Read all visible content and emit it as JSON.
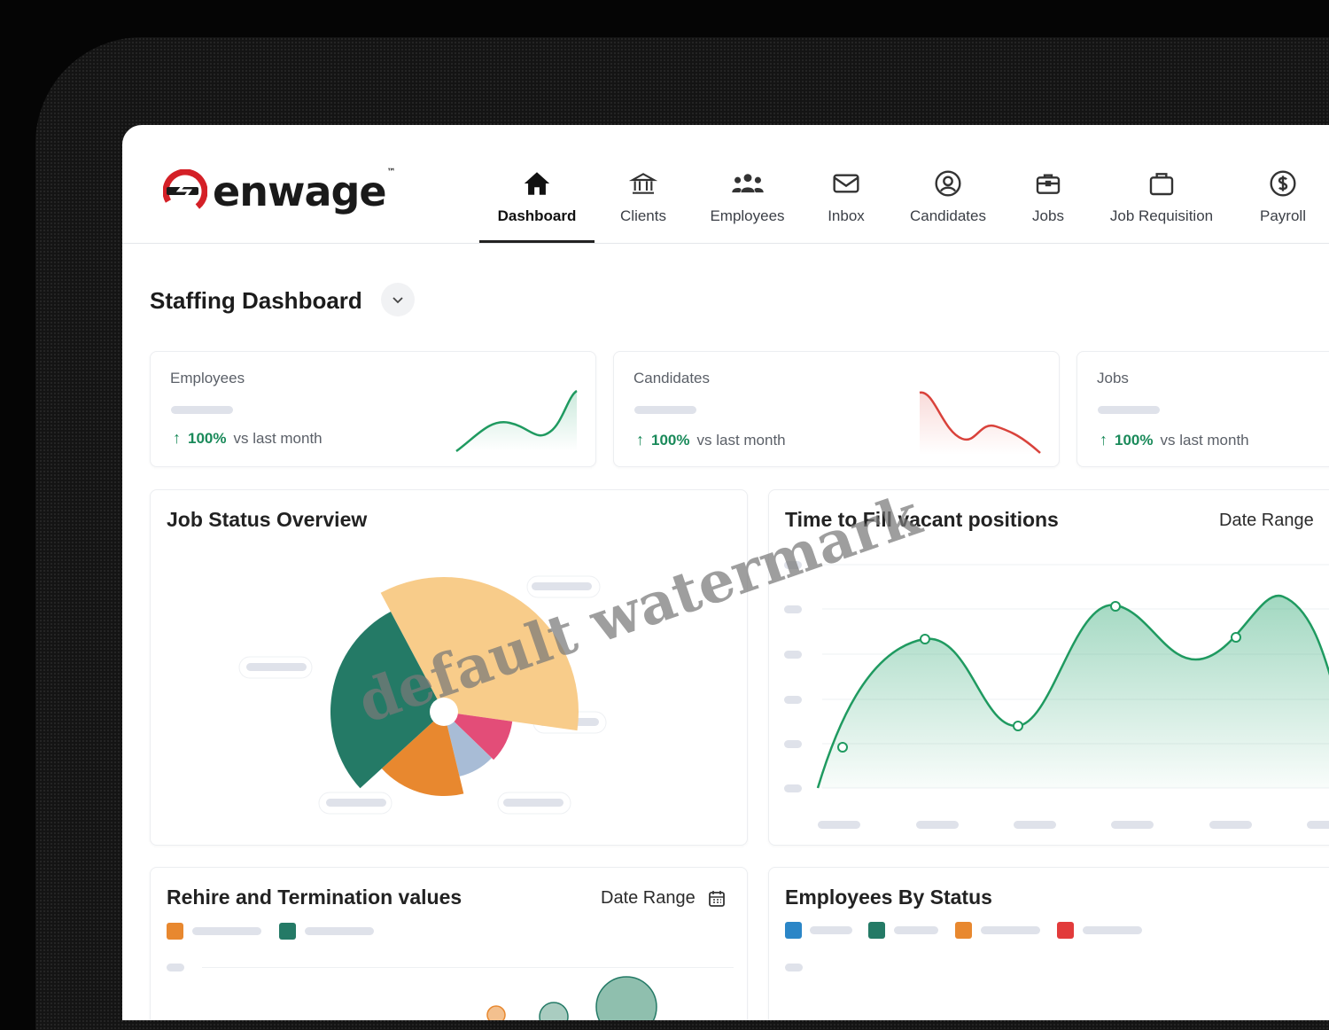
{
  "brand": {
    "name": "enwage",
    "tm": "™",
    "accent": "#d42027"
  },
  "nav": [
    {
      "label": "Dashboard",
      "icon": "home-icon",
      "active": true
    },
    {
      "label": "Clients",
      "icon": "bank-icon"
    },
    {
      "label": "Employees",
      "icon": "people-icon"
    },
    {
      "label": "Inbox",
      "icon": "mail-icon"
    },
    {
      "label": "Candidates",
      "icon": "user-circle-icon"
    },
    {
      "label": "Jobs",
      "icon": "briefcase-icon"
    },
    {
      "label": "Job Requisition",
      "icon": "bag-icon"
    },
    {
      "label": "Payroll",
      "icon": "dollar-circle-icon"
    }
  ],
  "page": {
    "title": "Staffing Dashboard"
  },
  "stats": [
    {
      "label": "Employees",
      "arrow": "↑",
      "delta": "100%",
      "suffix": "vs last month",
      "trend": "up",
      "color": "#1f9a60"
    },
    {
      "label": "Candidates",
      "arrow": "↑",
      "delta": "100%",
      "suffix": "vs last month",
      "trend": "down",
      "color": "#d9423b"
    },
    {
      "label": "Jobs",
      "arrow": "↑",
      "delta": "100%",
      "suffix": "vs last month"
    }
  ],
  "job_status": {
    "title": "Job Status Overview",
    "segments": [
      {
        "color": "#f8cc8a",
        "share": 0.35
      },
      {
        "color": "#e34d78",
        "share": 0.1
      },
      {
        "color": "#a8bcd6",
        "share": 0.09
      },
      {
        "color": "#e8882f",
        "share": 0.17
      },
      {
        "color": "#247a66",
        "share": 0.29
      }
    ]
  },
  "time_to_fill": {
    "title": "Time to Fill vacant positions",
    "date_range": "Date Range",
    "series_color": "#2fa874"
  },
  "rehire": {
    "title": "Rehire and Termination values",
    "date_range": "Date Range",
    "legend_colors": [
      "#e8882f",
      "#247a66"
    ]
  },
  "by_status": {
    "title": "Employees By Status",
    "legend_colors": [
      "#2b86c7",
      "#247a66",
      "#e8882f",
      "#e23b3b"
    ]
  },
  "watermark": "default watermark"
}
